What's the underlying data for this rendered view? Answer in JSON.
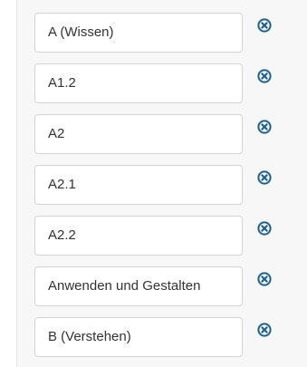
{
  "entries": [
    {
      "value": "A (Wissen)",
      "remove_icon": "remove-circle-icon"
    },
    {
      "value": "A1.2",
      "remove_icon": "remove-circle-icon"
    },
    {
      "value": "A2",
      "remove_icon": "remove-circle-icon"
    },
    {
      "value": "A2.1",
      "remove_icon": "remove-circle-icon"
    },
    {
      "value": "A2.2",
      "remove_icon": "remove-circle-icon"
    },
    {
      "value": "Anwenden und Gestalten",
      "remove_icon": "remove-circle-icon"
    },
    {
      "value": "B (Verstehen)",
      "remove_icon": "remove-circle-icon"
    }
  ],
  "colors": {
    "icon": "#1f5f91",
    "field_border": "#d3d3d3",
    "panel_bg": "#f7f7f7",
    "text": "#333333"
  }
}
